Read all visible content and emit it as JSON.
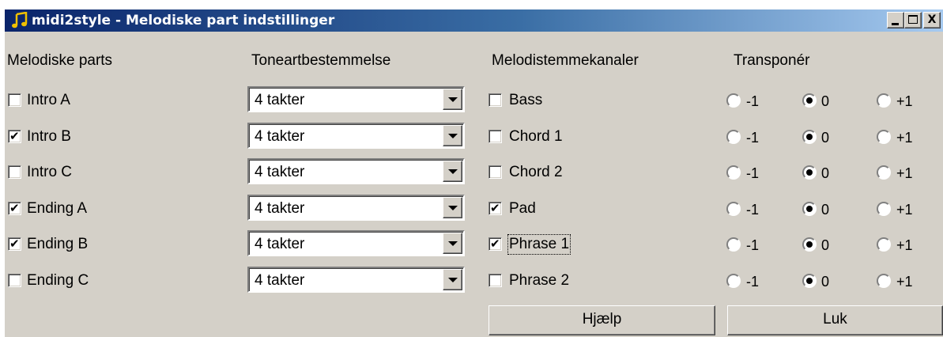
{
  "window": {
    "title": "midi2style - Melodiske part indstillinger",
    "controls": {
      "minimize": "_",
      "maximize": "□",
      "close": "X"
    }
  },
  "headers": {
    "parts": "Melodiske parts",
    "key": "Toneartbestemmelse",
    "channels": "Melodistemmekanaler",
    "transpose": "Transponér"
  },
  "parts": [
    {
      "label": "Intro A",
      "checked": false,
      "key": "4 takter"
    },
    {
      "label": "Intro B",
      "checked": true,
      "key": "4 takter"
    },
    {
      "label": "Intro C",
      "checked": false,
      "key": "4 takter"
    },
    {
      "label": "Ending A",
      "checked": true,
      "key": "4 takter"
    },
    {
      "label": "Ending B",
      "checked": true,
      "key": "4 takter"
    },
    {
      "label": "Ending C",
      "checked": false,
      "key": "4 takter"
    }
  ],
  "channels": [
    {
      "label": "Bass",
      "checked": false,
      "focused": false
    },
    {
      "label": "Chord 1",
      "checked": false,
      "focused": false
    },
    {
      "label": "Chord 2",
      "checked": false,
      "focused": false
    },
    {
      "label": "Pad",
      "checked": true,
      "focused": false
    },
    {
      "label": "Phrase 1",
      "checked": true,
      "focused": true
    },
    {
      "label": "Phrase 2",
      "checked": false,
      "focused": false
    }
  ],
  "transpose_options": [
    "-1",
    "0",
    "+1"
  ],
  "transpose_selected": [
    "0",
    "0",
    "0",
    "0",
    "0",
    "0"
  ],
  "buttons": {
    "help": "Hjælp",
    "close": "Luk"
  },
  "colors": {
    "titlebar": "#0a246a",
    "face": "#d4d0c8"
  },
  "icons": {
    "app": "music-note-icon"
  }
}
